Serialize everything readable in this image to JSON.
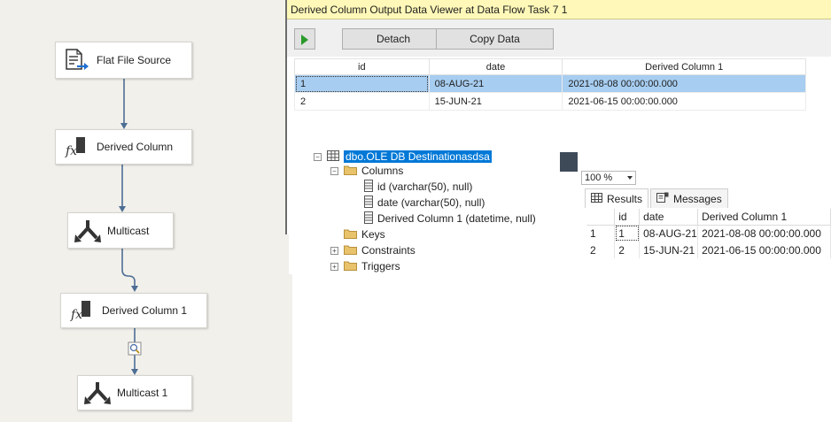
{
  "dataflow": {
    "nodes": [
      {
        "label": "Flat File Source",
        "icon": "flat-file-source-icon"
      },
      {
        "label": "Derived Column",
        "icon": "derived-column-icon"
      },
      {
        "label": "Multicast",
        "icon": "multicast-icon"
      },
      {
        "label": "Derived Column 1",
        "icon": "derived-column-icon"
      },
      {
        "label": "Multicast 1",
        "icon": "multicast-icon"
      }
    ],
    "colors": {
      "background": "#f2f0eb",
      "connector": "#4d6e94"
    }
  },
  "viewer": {
    "title": "Derived Column Output Data Viewer at Data Flow Task 7 1",
    "detach_label": "Detach",
    "copy_label": "Copy Data",
    "columns": [
      "id",
      "date",
      "Derived Column 1"
    ],
    "rows": [
      [
        "1",
        "08-AUG-21",
        "2021-08-08 00:00:00.000"
      ],
      [
        "2",
        "15-JUN-21",
        "2021-06-15 00:00:00.000"
      ]
    ],
    "selected_row": 0,
    "colors": {
      "title_bg": "#fff8b8",
      "selection": "#a7cdf0"
    }
  },
  "tree": {
    "table_label": "dbo.OLE DB Destinationasdsa",
    "columns_label": "Columns",
    "columns": [
      "id (varchar(50), null)",
      "date (varchar(50), null)",
      "Derived Column 1 (datetime, null)"
    ],
    "keys_label": "Keys",
    "constraints_label": "Constraints",
    "triggers_label": "Triggers",
    "expand_minus": "⊟",
    "expand_plus": "⊞"
  },
  "results": {
    "zoom": "100 %",
    "tabs": [
      "Results",
      "Messages"
    ],
    "columns": [
      "id",
      "date",
      "Derived Column 1"
    ],
    "rows": [
      {
        "num": "1",
        "cells": [
          "1",
          "08-AUG-21",
          "2021-08-08 00:00:00.000"
        ]
      },
      {
        "num": "2",
        "cells": [
          "2",
          "15-JUN-21",
          "2021-06-15 00:00:00.000"
        ]
      }
    ]
  }
}
